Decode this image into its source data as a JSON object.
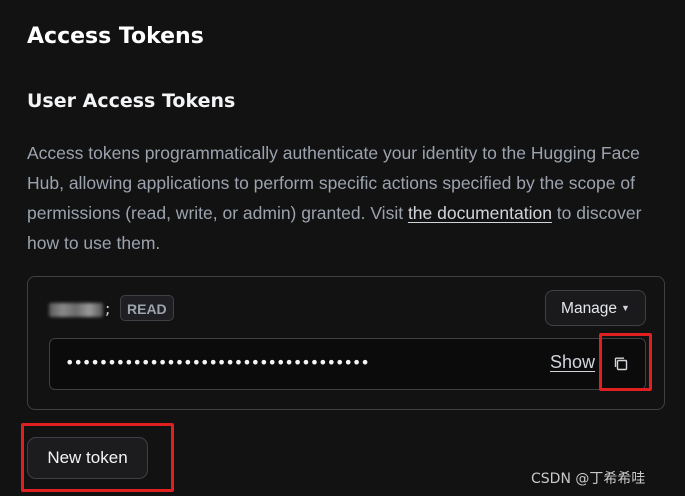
{
  "header": {
    "title": "Access Tokens"
  },
  "section": {
    "title": "User Access Tokens",
    "description_before_link": "Access tokens programmatically authenticate your identity to the Hugging Face Hub, allowing applications to perform specific actions specified by the scope of permissions (read, write, or admin) granted. Visit ",
    "link_text": "the documentation",
    "description_after_link": " to discover how to use them."
  },
  "token": {
    "name_separator": ";",
    "role": "READ",
    "manage_label": "Manage",
    "manage_icon": "chevron-down-icon",
    "masked_value": "••••••••••••••••••••••••••••••••••••",
    "show_label": "Show",
    "copy_icon": "copy-icon"
  },
  "actions": {
    "new_token_label": "New token"
  },
  "watermark": {
    "text": "CSDN @丁希希哇"
  },
  "colors": {
    "background": "#121212",
    "border": "#3f3f46",
    "highlight": "#e02020",
    "text_muted": "#9ca3af"
  }
}
